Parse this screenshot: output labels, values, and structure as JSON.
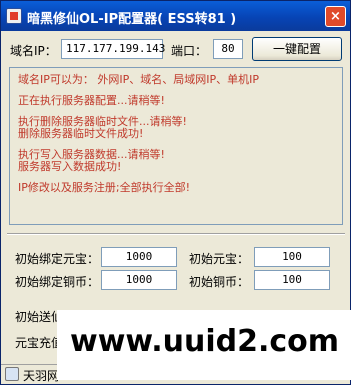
{
  "window": {
    "title": "暗黑修仙OL-IP配置器( ESS转81 )",
    "close_glyph": "×"
  },
  "config": {
    "domain_label": "域名IP：",
    "domain_value": "117.177.199.143",
    "port_label": "端口：",
    "port_value": "80",
    "apply_button": "一键配置"
  },
  "log": [
    "域名IP可以为： 外网IP、域名、局域网IP、单机IP",
    "正在执行服务器配置...请稍等!",
    "执行删除服务器临时文件...请稍等!",
    "删除服务器临时文件成功!",
    "执行写入服务器数据...请稍等!",
    "服务器写入数据成功!",
    "IP修改以及服务注册;全部执行全部!"
  ],
  "settings": {
    "bind_yuanbao_label": "初始绑定元宝：",
    "bind_yuanbao_value": "1000",
    "yuanbao_label": "初始元宝：",
    "yuanbao_value": "100",
    "bind_copper_label": "初始绑定铜币：",
    "bind_copper_value": "1000",
    "copper_label": "初始铜币：",
    "copper_value": "100",
    "send_label": "初始送仙",
    "recharge_label": "元宝充值"
  },
  "status": {
    "text": "天羽网"
  },
  "watermark": {
    "text": "www.uuid2.com"
  },
  "colors": {
    "log_text": "#c0392b",
    "title_bar": "#0a5ed8"
  }
}
